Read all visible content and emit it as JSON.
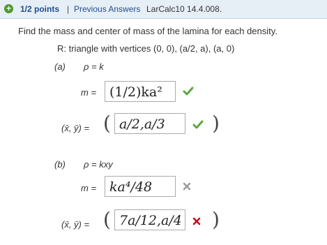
{
  "header": {
    "points": "1/2 points",
    "separator": "|",
    "previous_answers": "Previous Answers",
    "question_id": "LarCalc10 14.4.008."
  },
  "question": {
    "prompt": "Find the mass and center of mass of the lamina for each density.",
    "region": "R: triangle with vertices (0, 0), (a/2, a), (a, 0)"
  },
  "part_a": {
    "label": "(a)",
    "density": "ρ = k",
    "mass_label": "m =",
    "mass_answer": "(1/2)ka²",
    "mass_status": "correct",
    "center_label": "(x̄, ȳ) =",
    "center_answer": "a/2,a/3",
    "center_status": "correct"
  },
  "part_b": {
    "label": "(b)",
    "density": "ρ = kxy",
    "mass_label": "m =",
    "mass_answer": "ka⁴/48",
    "mass_status": "incorrect",
    "center_label": "(x̄, ȳ) =",
    "center_answer": "7a/12,a/4",
    "center_status": "incorrect"
  },
  "colors": {
    "correct": "#5aa83c",
    "incorrect": "#d0021b",
    "neutral_x": "#9a9a9a",
    "link": "#1f4f8f"
  }
}
